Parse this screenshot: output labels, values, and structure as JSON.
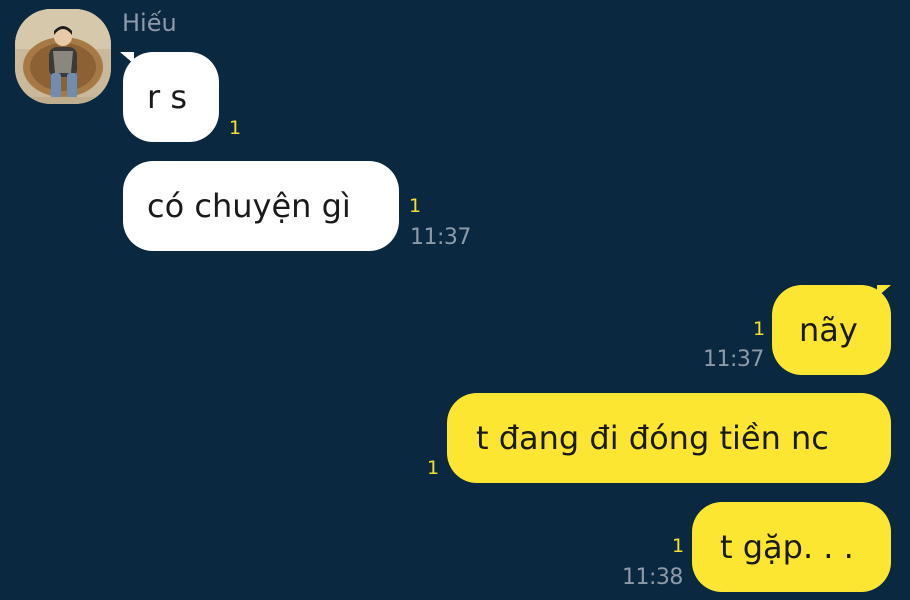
{
  "chat": {
    "sender_name": "Hiếu",
    "messages": [
      {
        "direction": "in",
        "text": "r s",
        "unread": "1"
      },
      {
        "direction": "in",
        "text": "có chuyện gì",
        "unread": "1",
        "time": "11:37"
      },
      {
        "direction": "out",
        "text": "nãy",
        "unread": "1",
        "time": "11:37"
      },
      {
        "direction": "out",
        "text": "t đang đi đóng tiền nc",
        "unread": "1"
      },
      {
        "direction": "out",
        "text": "t gặp. . .",
        "unread": "1",
        "time": "11:38"
      }
    ]
  },
  "colors": {
    "background": "#0b2841",
    "incoming_bubble": "#ffffff",
    "outgoing_bubble": "#fde632",
    "unread_count": "#f6e12a",
    "meta_text": "#8d9aa8"
  }
}
